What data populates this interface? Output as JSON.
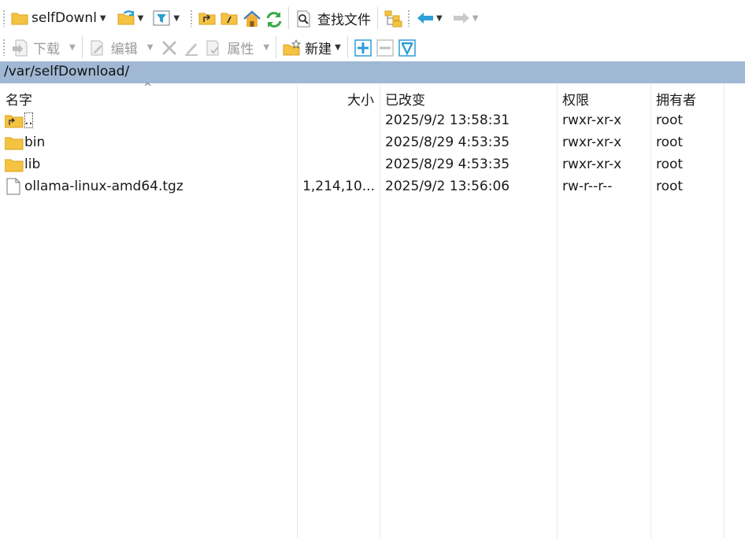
{
  "toolbar1": {
    "location_label": "selfDownl",
    "find_files_label": "查找文件"
  },
  "toolbar2": {
    "download_label": "下载",
    "edit_label": "编辑",
    "properties_label": "属性",
    "new_label": "新建"
  },
  "path": "/var/selfDownload/",
  "columns": {
    "name": "名字",
    "size": "大小",
    "modified": "已改变",
    "permissions": "权限",
    "owner": "拥有者"
  },
  "rows": [
    {
      "name": "..",
      "size": "",
      "modified": "2025/9/2 13:58:31",
      "permissions": "rwxr-xr-x",
      "owner": "root",
      "icon": "parent-folder-icon"
    },
    {
      "name": "bin",
      "size": "",
      "modified": "2025/8/29 4:53:35",
      "permissions": "rwxr-xr-x",
      "owner": "root",
      "icon": "folder-icon"
    },
    {
      "name": "lib",
      "size": "",
      "modified": "2025/8/29 4:53:35",
      "permissions": "rwxr-xr-x",
      "owner": "root",
      "icon": "folder-icon"
    },
    {
      "name": "ollama-linux-amd64.tgz",
      "size": "1,214,10...",
      "modified": "2025/9/2 13:56:06",
      "permissions": "rw-r--r--",
      "owner": "root",
      "icon": "file-icon"
    }
  ],
  "colors": {
    "path_bar": "#a0b8d4",
    "folder": "#f5c342",
    "refresh_green": "#3aa84a",
    "arrow_blue": "#2c9ed8"
  }
}
